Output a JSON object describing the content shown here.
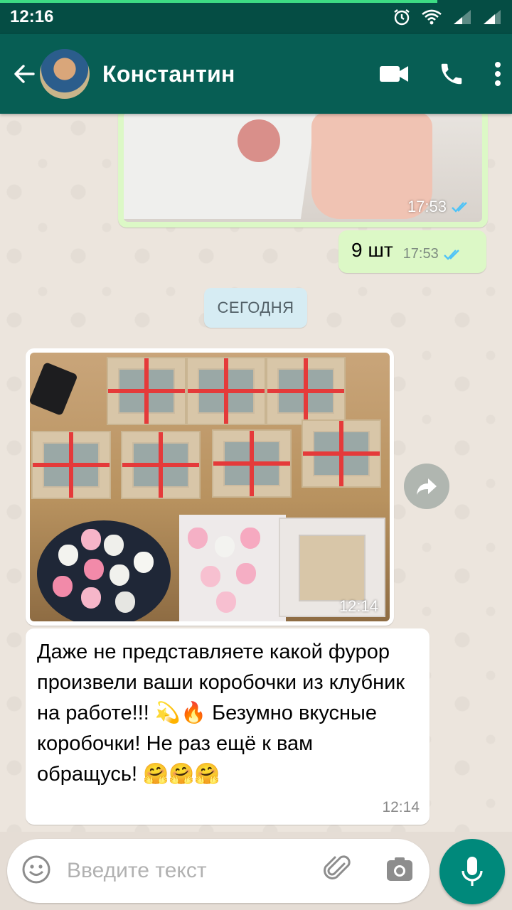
{
  "status_bar": {
    "time": "12:16",
    "icons": [
      "alarm-icon",
      "wifi-icon",
      "signal-icon",
      "signal-icon"
    ]
  },
  "header": {
    "contact_name": "Константин",
    "actions": [
      "video-call-icon",
      "phone-icon",
      "more-vert-icon"
    ]
  },
  "messages": [
    {
      "type": "outgoing-photo",
      "time": "17:53",
      "status": "read"
    },
    {
      "type": "outgoing-text",
      "text": "9 шт",
      "time": "17:53",
      "status": "read"
    },
    {
      "type": "date-separator",
      "text": "СЕГОДНЯ"
    },
    {
      "type": "incoming-photo",
      "time": "12:14"
    },
    {
      "type": "incoming-text",
      "text": "Даже не представляете какой фурор произвели ваши коробочки из клубник на работе!!! 💫🔥 Безумно вкусные коробочки! Не раз ещё к вам обращусь! 🤗🤗🤗",
      "time": "12:14"
    }
  ],
  "composer": {
    "placeholder": "Введите текст",
    "icons": [
      "emoji-icon",
      "attach-icon",
      "camera-icon",
      "mic-icon"
    ]
  },
  "colors": {
    "header": "#075e54",
    "status_bar": "#054d44",
    "outgoing_bubble": "#dcf8c6",
    "incoming_bubble": "#ffffff",
    "read_ticks": "#4fc3f7",
    "fab": "#00897b"
  }
}
